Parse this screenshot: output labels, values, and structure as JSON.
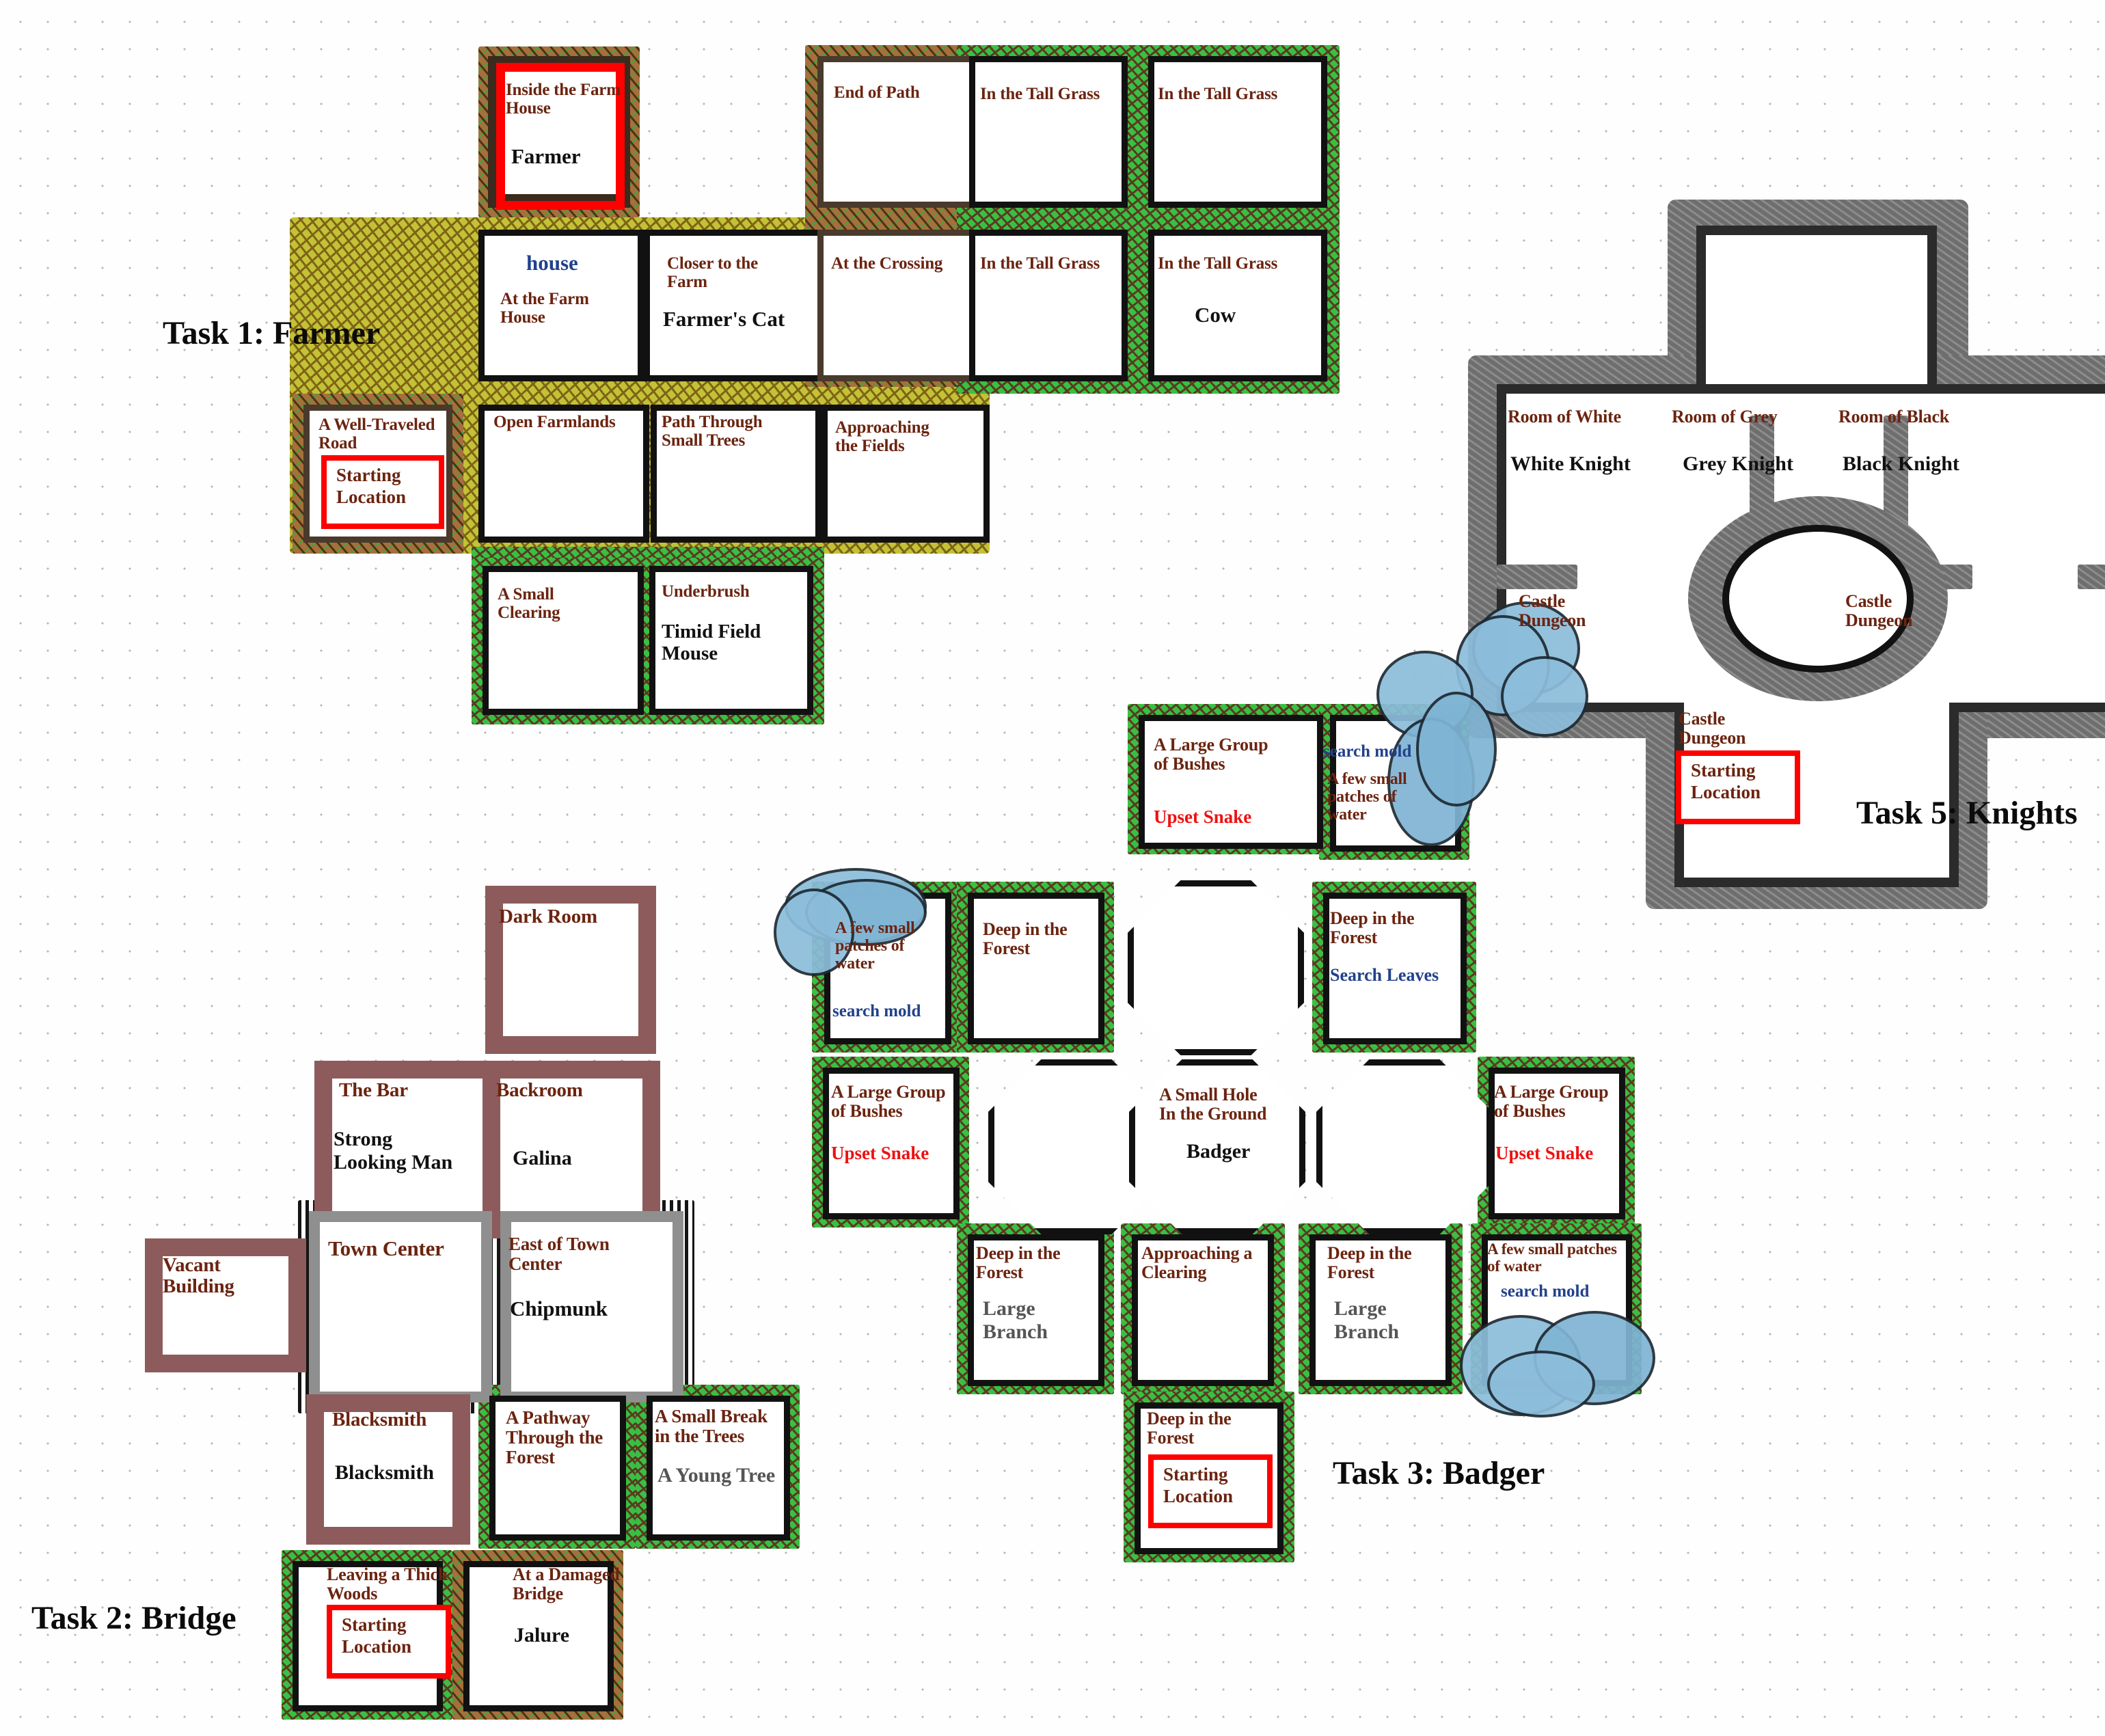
{
  "page": {
    "title": "Adventure Task Maps",
    "background": "#ffffff",
    "grid": "dotted"
  },
  "palette": {
    "label_color": "#6b2410",
    "npc_color": "#111111",
    "hostile_color": "#ee1111",
    "action_color": "#21418c",
    "highlight_color": "#ff0000",
    "grass": "#39c043",
    "field": "#c3c236",
    "dirt": "#a4703c",
    "stone": "#777777",
    "brick": "#8d5b5b",
    "water": "#8cbddb"
  },
  "tasks": [
    {
      "id": "task1",
      "title": "Task 1: Farmer"
    },
    {
      "id": "task2",
      "title": "Task 2: Bridge"
    },
    {
      "id": "task3",
      "title": "Task 3: Badger"
    },
    {
      "id": "task5",
      "title": "Task 5: Knights"
    }
  ],
  "common": {
    "starting_location": "Starting\nLocation",
    "starting_line1": "Starting",
    "starting_line2": "Location"
  },
  "task1": {
    "rooms": [
      {
        "name": "Inside the Farm House",
        "npc": "Farmer",
        "terrain": "dirt",
        "highlighted": true
      },
      {
        "name": "At the Farm House",
        "action": "house",
        "terrain": "field"
      },
      {
        "name": "Closer to the Farm",
        "npc": "Farmer's Cat",
        "terrain": "field"
      },
      {
        "name": "At the Crossing",
        "terrain": "dirt"
      },
      {
        "name": "End of Path",
        "terrain": "dirt"
      },
      {
        "name": "In the Tall Grass",
        "terrain": "grass"
      },
      {
        "name": "In the Tall Grass",
        "terrain": "grass"
      },
      {
        "name": "In the Tall Grass",
        "terrain": "grass"
      },
      {
        "name": "In the Tall Grass",
        "npc": "Cow",
        "terrain": "grass"
      },
      {
        "name": "A Well-Traveled Road",
        "terrain": "dirt",
        "start": true
      },
      {
        "name": "Open Farmlands",
        "terrain": "field"
      },
      {
        "name": "Path Through Small Trees",
        "terrain": "field"
      },
      {
        "name": "Approaching the Fields",
        "terrain": "field"
      },
      {
        "name": "A Small Clearing",
        "terrain": "grass"
      },
      {
        "name": "Underbrush",
        "npc": "Timid Field Mouse",
        "terrain": "grass"
      }
    ]
  },
  "task2": {
    "rooms": [
      {
        "name": "Dark Room",
        "terrain": "brick"
      },
      {
        "name": "The Bar",
        "npc": "Strong Looking Man",
        "terrain": "brick"
      },
      {
        "name": "Backroom",
        "npc": "Galina",
        "terrain": "brick"
      },
      {
        "name": "Vacant Building",
        "terrain": "brick"
      },
      {
        "name": "Town Center",
        "terrain": "wood"
      },
      {
        "name": "East of Town Center",
        "npc": "Chipmunk",
        "terrain": "wood"
      },
      {
        "name": "Blacksmith",
        "npc": "Blacksmith",
        "terrain": "brick"
      },
      {
        "name": "A Pathway Through the Forest",
        "terrain": "grass"
      },
      {
        "name": "A Small Break in the Trees",
        "npc": "A Young Tree",
        "terrain": "grass"
      },
      {
        "name": "Leaving a Thick Woods",
        "terrain": "grass",
        "start": true
      },
      {
        "name": "At a Damaged Bridge",
        "npc": "Jalure",
        "terrain": "dirt"
      }
    ]
  },
  "task3": {
    "rooms": [
      {
        "name": "A Large Group of Bushes",
        "npc": "Upset Snake",
        "terrain": "grass"
      },
      {
        "name": "A few small patches of water",
        "action": "search mold",
        "terrain": "grass"
      },
      {
        "name": "A few small patches of water",
        "action": "search mold",
        "terrain": "grass"
      },
      {
        "name": "Deep in the Forest",
        "terrain": "grass"
      },
      {
        "name": "Deep in the Forest",
        "action": "Search Leaves",
        "terrain": "grass"
      },
      {
        "name": "A Large Group of Bushes",
        "npc": "Upset Snake",
        "terrain": "grass"
      },
      {
        "name": "A Large Group of Bushes",
        "npc": "Upset Snake",
        "terrain": "grass"
      },
      {
        "name": "A Small Hole In the Ground",
        "npc": "Badger",
        "terrain": "dirt"
      },
      {
        "name": "Deep in the Forest",
        "npc": "Large Branch",
        "terrain": "grass"
      },
      {
        "name": "Approaching a Clearing",
        "terrain": "grass"
      },
      {
        "name": "Deep in the Forest",
        "npc": "Large Branch",
        "terrain": "grass"
      },
      {
        "name": "A few small patches of water",
        "action": "search mold",
        "terrain": "grass"
      },
      {
        "name": "Deep in the Forest",
        "terrain": "grass",
        "start": true
      }
    ]
  },
  "task5": {
    "rooms": [
      {
        "name": "Room of White",
        "npc": "White Knight",
        "terrain": "stone"
      },
      {
        "name": "Room of Grey",
        "npc": "Grey Knight",
        "terrain": "stone"
      },
      {
        "name": "Room of Black",
        "npc": "Black Knight",
        "terrain": "stone"
      },
      {
        "name": "Castle Dungeon",
        "terrain": "stone"
      },
      {
        "name": "Castle Dungeon",
        "terrain": "stone"
      },
      {
        "name": "Castle Dungeon",
        "terrain": "stone",
        "start": true
      }
    ]
  },
  "labels": {
    "t1": {
      "inside_farm_house": "Inside the Farm\nHouse",
      "inside_farm_house_l1": "Inside the Farm",
      "inside_farm_house_l2": "House",
      "farmer": "Farmer",
      "house_action": "house",
      "at_farm_house_l1": "At the Farm",
      "at_farm_house_l2": "House",
      "closer_to_farm_l1": "Closer to the",
      "closer_to_farm_l2": "Farm",
      "farmers_cat": "Farmer's Cat",
      "at_crossing": "At the Crossing",
      "end_of_path": "End of Path",
      "tall_grass_1": "In the Tall Grass",
      "tall_grass_2": "In the Tall Grass",
      "tall_grass_3": "In the Tall Grass",
      "tall_grass_4": "In the Tall Grass",
      "cow": "Cow",
      "well_traveled_l1": "A Well-Traveled",
      "well_traveled_l2": "Road",
      "open_farmlands": "Open Farmlands",
      "path_small_trees_l1": "Path Through",
      "path_small_trees_l2": "Small Trees",
      "approaching_fields_l1": "Approaching",
      "approaching_fields_l2": "the Fields",
      "small_clearing_l1": "A Small",
      "small_clearing_l2": "Clearing",
      "underbrush": "Underbrush",
      "timid_mouse_l1": "Timid Field",
      "timid_mouse_l2": "Mouse"
    },
    "t2": {
      "dark_room": "Dark Room",
      "the_bar": "The Bar",
      "strong_man_l1": "Strong",
      "strong_man_l2": "Looking Man",
      "backroom": "Backroom",
      "galina": "Galina",
      "vacant_l1": "Vacant",
      "vacant_l2": "Building",
      "town_center": "Town Center",
      "east_town_l1": "East of Town",
      "east_town_l2": "Center",
      "chipmunk": "Chipmunk",
      "blacksmith_room": "Blacksmith",
      "blacksmith_npc": "Blacksmith",
      "pathway_l1": "A Pathway",
      "pathway_l2": "Through the",
      "pathway_l3": "Forest",
      "small_break_l1": "A Small Break",
      "small_break_l2": "in the Trees",
      "young_tree": "A Young Tree",
      "leaving_woods_l1": "Leaving a Thick",
      "leaving_woods_l2": "Woods",
      "damaged_bridge_l1": "At a Damaged",
      "damaged_bridge_l2": "Bridge",
      "jalure": "Jalure"
    },
    "t3": {
      "bushes_top_l1": "A Large Group",
      "bushes_top_l2": "of Bushes",
      "snake_top": "Upset Snake",
      "search_mold_top": "search mold",
      "water_top_l1": "A few small",
      "water_top_l2": "patches of",
      "water_top_l3": "water",
      "water_left_l1": "A few small",
      "water_left_l2": "patches of",
      "water_left_l3": "water",
      "search_mold_left": "search mold",
      "deep_forest_1": "Deep in the",
      "deep_forest_1b": "Forest",
      "deep_forest_2": "Deep in the",
      "deep_forest_2b": "Forest",
      "search_leaves": "Search Leaves",
      "bushes_left_l1": "A Large Group",
      "bushes_left_l2": "of Bushes",
      "snake_left": "Upset Snake",
      "bushes_right_l1": "A Large Group",
      "bushes_right_l2": "of Bushes",
      "snake_right": "Upset Snake",
      "small_hole_l1": "A Small Hole",
      "small_hole_l2": "In the Ground",
      "badger": "Badger",
      "deep_forest_3": "Deep in the",
      "deep_forest_3b": "Forest",
      "large_branch_l1": "Large",
      "large_branch_l2": "Branch",
      "approaching_clearing_l1": "Approaching a",
      "approaching_clearing_l2": "Clearing",
      "deep_forest_4": "Deep in the",
      "deep_forest_4b": "Forest",
      "large_branch2_l1": "Large",
      "large_branch2_l2": "Branch",
      "water_right_l1": "A few small patches",
      "water_right_l2": "of water",
      "search_mold_right": "search mold",
      "deep_forest_5": "Deep in the",
      "deep_forest_5b": "Forest"
    },
    "t5": {
      "room_white": "Room of White",
      "white_knight": "White Knight",
      "room_grey": "Room of Grey",
      "grey_knight": "Grey Knight",
      "room_black": "Room of Black",
      "black_knight": "Black Knight",
      "dungeon_left_l1": "Castle",
      "dungeon_left_l2": "Dungeon",
      "dungeon_right_l1": "Castle",
      "dungeon_right_l2": "Dungeon",
      "dungeon_bottom_l1": "Castle",
      "dungeon_bottom_l2": "Dungeon"
    }
  }
}
